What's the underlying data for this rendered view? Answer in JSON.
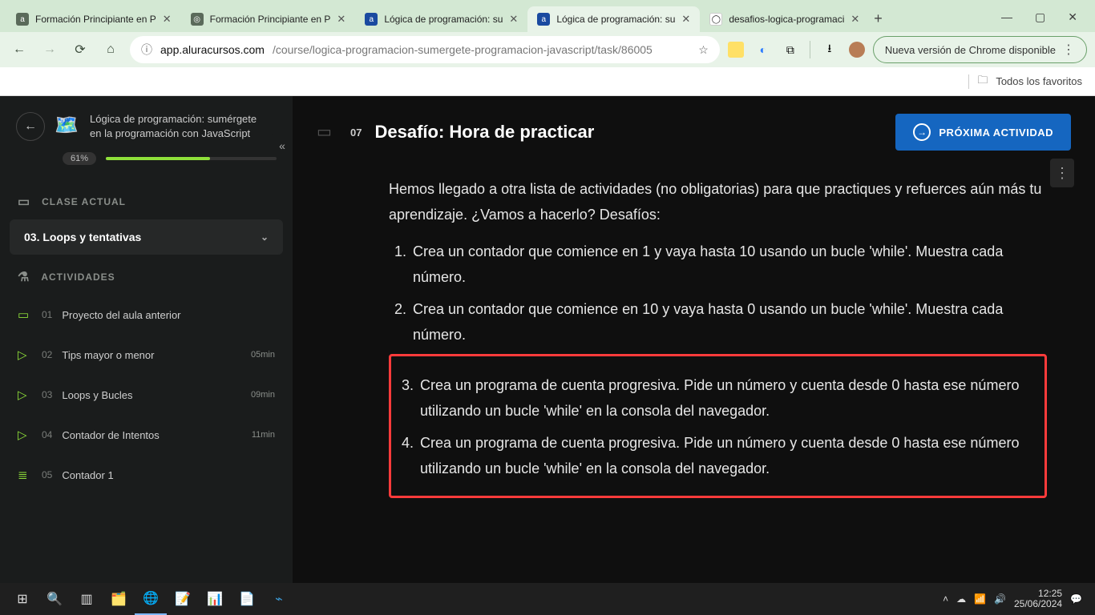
{
  "browser": {
    "tabs": [
      {
        "label": "Formación Principiante en P"
      },
      {
        "label": "Formación Principiante en P"
      },
      {
        "label": "Lógica de programación: su"
      },
      {
        "label": "Lógica de programación: su"
      },
      {
        "label": "desafios-logica-programaci"
      }
    ],
    "url_host": "app.aluracursos.com",
    "url_path": "/course/logica-programacion-sumergete-programacion-javascript/task/86005",
    "update_chip": "Nueva versión de Chrome disponible",
    "bookmarks_all": "Todos los favoritos"
  },
  "sidebar": {
    "course_title": "Lógica de programación: sumérgete en la programación con JavaScript",
    "progress_pct": "61%",
    "section_current": "CLASE ACTUAL",
    "current_class": "03. Loops y tentativas",
    "section_activities": "ACTIVIDADES",
    "activities": [
      {
        "num": "01",
        "title": "Proyecto del aula anterior",
        "dur": "",
        "icon": "book"
      },
      {
        "num": "02",
        "title": "Tips mayor o menor",
        "dur": "05min",
        "icon": "play"
      },
      {
        "num": "03",
        "title": "Loops y Bucles",
        "dur": "09min",
        "icon": "play"
      },
      {
        "num": "04",
        "title": "Contador de Intentos",
        "dur": "11min",
        "icon": "play"
      },
      {
        "num": "05",
        "title": "Contador 1",
        "dur": "",
        "icon": "list"
      }
    ]
  },
  "main": {
    "lesson_num": "07",
    "lesson_title": "Desafío: Hora de practicar",
    "next_btn": "PRÓXIMA ACTIVIDAD",
    "intro": "Hemos llegado a otra lista de actividades (no obligatorias) para que practiques y refuerces aún más tu aprendizaje. ¿Vamos a hacerlo? Desafíos:",
    "items": [
      "Crea un contador que comience en 1 y vaya hasta 10 usando un bucle 'while'. Muestra cada número.",
      "Crea un contador que comience en 10 y vaya hasta 0 usando un bucle 'while'. Muestra cada número.",
      "Crea un programa de cuenta progresiva. Pide un número y cuenta desde 0 hasta ese número utilizando un bucle 'while' en la consola del navegador.",
      "Crea un programa de cuenta progresiva. Pide un número y cuenta desde 0 hasta ese número utilizando un bucle 'while' en la consola del navegador."
    ]
  },
  "taskbar": {
    "time": "12:25",
    "date": "25/06/2024"
  }
}
